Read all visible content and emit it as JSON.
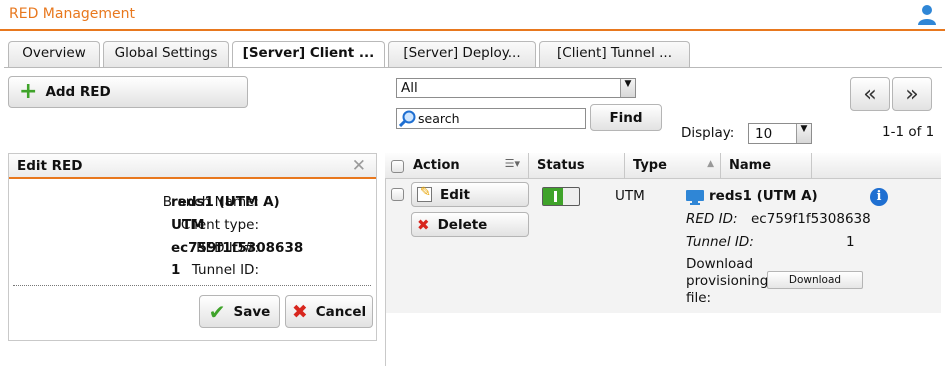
{
  "app": {
    "title": "RED Management"
  },
  "tabs": [
    {
      "label": "Overview"
    },
    {
      "label": "Global Settings"
    },
    {
      "label": "[Server] Client ..."
    },
    {
      "label": "[Server] Deploy..."
    },
    {
      "label": "[Client] Tunnel ..."
    }
  ],
  "toolbar": {
    "add_label": "Add RED",
    "filter_value": "All",
    "search_placeholder": "search",
    "find_label": "Find",
    "display_label": "Display:",
    "display_value": "10",
    "range_text": "1-1 of 1",
    "prev_label": "«",
    "next_label": "»"
  },
  "edit_panel": {
    "title": "Edit RED",
    "fields": [
      {
        "label": "Branch Name:",
        "value": "reds1 (UTM A)"
      },
      {
        "label": "Client type:",
        "value": "UTM"
      },
      {
        "label": "RED ID#:",
        "value": "ec759f1f5308638"
      },
      {
        "label": "Tunnel ID:",
        "value": "1"
      }
    ],
    "save_label": "Save",
    "cancel_label": "Cancel"
  },
  "grid": {
    "columns": {
      "action": "Action",
      "status": "Status",
      "type": "Type",
      "name": "Name"
    },
    "row": {
      "edit_label": "Edit",
      "delete_label": "Delete",
      "type": "UTM",
      "name": "reds1 (UTM A)",
      "red_id_label": "RED ID:",
      "red_id_value": "ec759f1f5308638",
      "tunnel_id_label": "Tunnel ID:",
      "tunnel_id_value": "1",
      "download_text_1": "Download",
      "download_text_2": "provisioning",
      "download_text_3": "file:",
      "download_button": "Download"
    }
  },
  "colors": {
    "accent": "#e8781e",
    "enabled_toggle": "#3fa32a",
    "info_blue": "#1f6fd1",
    "cancel_red": "#d8261e"
  },
  "icons": [
    "user-icon",
    "plus-icon",
    "search-icon",
    "close-icon",
    "checkmark-icon",
    "x-icon",
    "edit-icon",
    "monitor-icon",
    "info-icon",
    "sort-icon"
  ]
}
